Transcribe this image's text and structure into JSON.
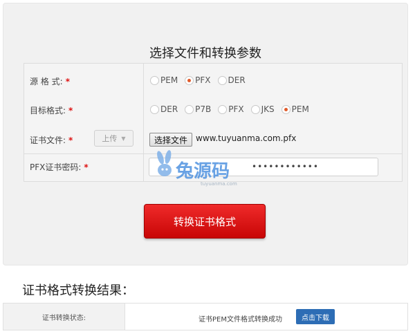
{
  "panel": {
    "title": "选择文件和转换参数"
  },
  "form": {
    "source_format": {
      "label": "源 格 式:",
      "required": "*",
      "options": [
        {
          "label": "PEM",
          "checked": false
        },
        {
          "label": "PFX",
          "checked": true
        },
        {
          "label": "DER",
          "checked": false
        }
      ]
    },
    "target_format": {
      "label": "目标格式:",
      "required": "*",
      "options": [
        {
          "label": "DER",
          "checked": false
        },
        {
          "label": "P7B",
          "checked": false
        },
        {
          "label": "PFX",
          "checked": false
        },
        {
          "label": "JKS",
          "checked": false
        },
        {
          "label": "PEM",
          "checked": true
        }
      ]
    },
    "cert_file": {
      "label": "证书文件:",
      "required": "*",
      "upload_label": "上传",
      "choose_file_label": "选择文件",
      "file_name": "www.tuyuanma.com.pfx"
    },
    "pfx_password": {
      "label": "PFX证书密码:",
      "required": "*",
      "value": "••••••••••••"
    }
  },
  "watermark": {
    "brand": "兔源码",
    "url": "tuyuanma.com"
  },
  "convert_button": {
    "label": "转换证书格式"
  },
  "result": {
    "title": "证书格式转换结果：",
    "status_label": "证书转换状态:",
    "message": "证书PEM文件格式转换成功",
    "download_label": "点击下载"
  },
  "colors": {
    "accent_red": "#d90b0b",
    "required_red": "#dd1111",
    "radio_checked": "#e05a2a",
    "download_blue": "#2d6db5"
  }
}
